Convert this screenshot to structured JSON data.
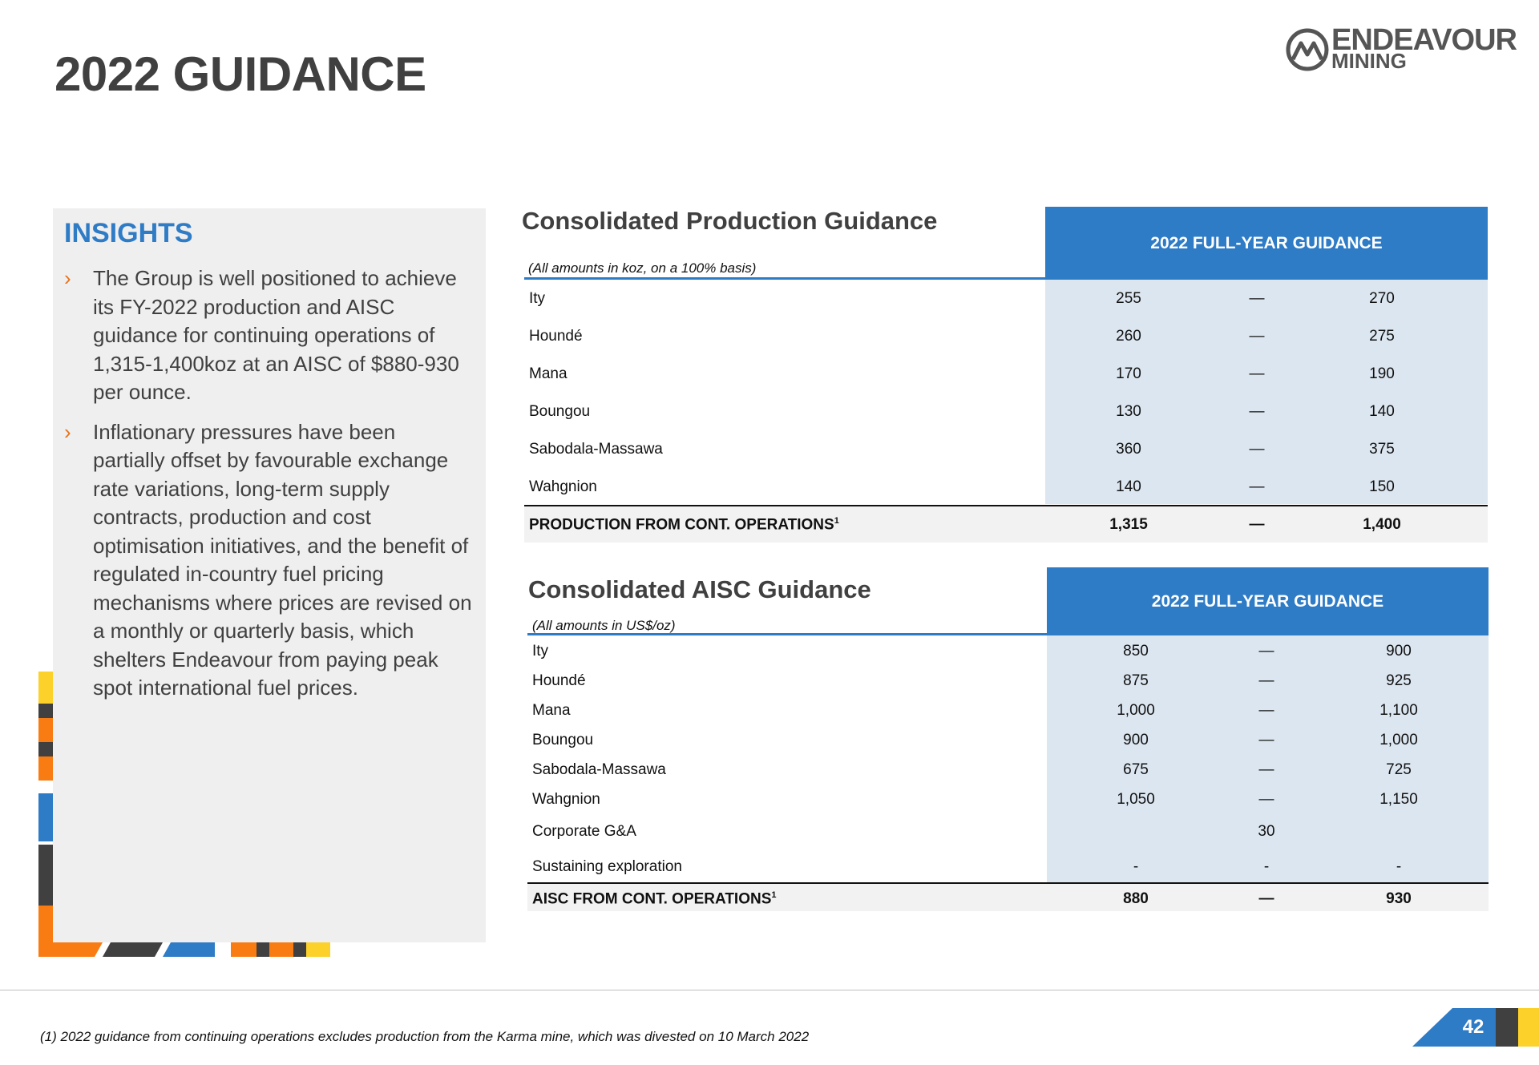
{
  "page": {
    "title": "2022 GUIDANCE",
    "page_number": "42",
    "footnote": "(1) 2022 guidance from continuing operations excludes production from the Karma mine, which was divested on 10 March 2022"
  },
  "logo": {
    "line1": "ENDEAVOUR",
    "line2": "MINING",
    "icon": "endeavour-mountain-logo-icon"
  },
  "insights": {
    "title": "INSIGHTS",
    "bullet_glyph": "›",
    "items": [
      "The Group is well positioned to achieve its FY-2022 production and AISC guidance for continuing operations of 1,315-1,400koz at an AISC of $880-930 per ounce.",
      "Inflationary pressures have been partially offset by favourable exchange rate variations, long-term supply contracts, production and cost optimisation initiatives, and the benefit of regulated in-country fuel pricing mechanisms where prices are revised on a monthly or quarterly basis, which shelters Endeavour from paying peak spot international fuel prices."
    ]
  },
  "production": {
    "title": "Consolidated Production Guidance",
    "note": "(All amounts in koz, on a 100% basis)",
    "header": "2022 FULL-YEAR GUIDANCE",
    "rows": [
      {
        "label": "Ity",
        "low": "255",
        "sep": "—",
        "high": "270"
      },
      {
        "label": "Houndé",
        "low": "260",
        "sep": "—",
        "high": "275"
      },
      {
        "label": "Mana",
        "low": "170",
        "sep": "—",
        "high": "190"
      },
      {
        "label": "Boungou",
        "low": "130",
        "sep": "—",
        "high": "140"
      },
      {
        "label": "Sabodala-Massawa",
        "low": "360",
        "sep": "—",
        "high": "375"
      },
      {
        "label": "Wahgnion",
        "low": "140",
        "sep": "—",
        "high": "150"
      }
    ],
    "total": {
      "label": "PRODUCTION FROM CONT. OPERATIONS",
      "sup": "1",
      "low": "1,315",
      "sep": "—",
      "high": "1,400"
    }
  },
  "aisc": {
    "title": "Consolidated AISC Guidance",
    "note": "(All amounts in US$/oz)",
    "header": "2022 FULL-YEAR GUIDANCE",
    "rows": [
      {
        "label": "Ity",
        "low": "850",
        "sep": "—",
        "high": "900"
      },
      {
        "label": "Houndé",
        "low": "875",
        "sep": "—",
        "high": "925"
      },
      {
        "label": "Mana",
        "low": "1,000",
        "sep": "—",
        "high": "1,100"
      },
      {
        "label": "Boungou",
        "low": "900",
        "sep": "—",
        "high": "1,000"
      },
      {
        "label": "Sabodala-Massawa",
        "low": "675",
        "sep": "—",
        "high": "725"
      },
      {
        "label": "Wahgnion",
        "low": "1,050",
        "sep": "—",
        "high": "1,150"
      },
      {
        "label": "Corporate G&A",
        "low": "",
        "sep": "30",
        "high": ""
      },
      {
        "label": "Sustaining exploration",
        "low": "-",
        "sep": "-",
        "high": "-"
      }
    ],
    "total": {
      "label": "AISC FROM CONT. OPERATIONS",
      "sup": "1",
      "low": "880",
      "sep": "—",
      "high": "930"
    }
  },
  "colors": {
    "accent_blue": "#2e7bc6",
    "accent_orange": "#f97c12",
    "accent_yellow": "#fcd12a",
    "dark_grey": "#404040",
    "cell_shade": "#dce6f0"
  }
}
